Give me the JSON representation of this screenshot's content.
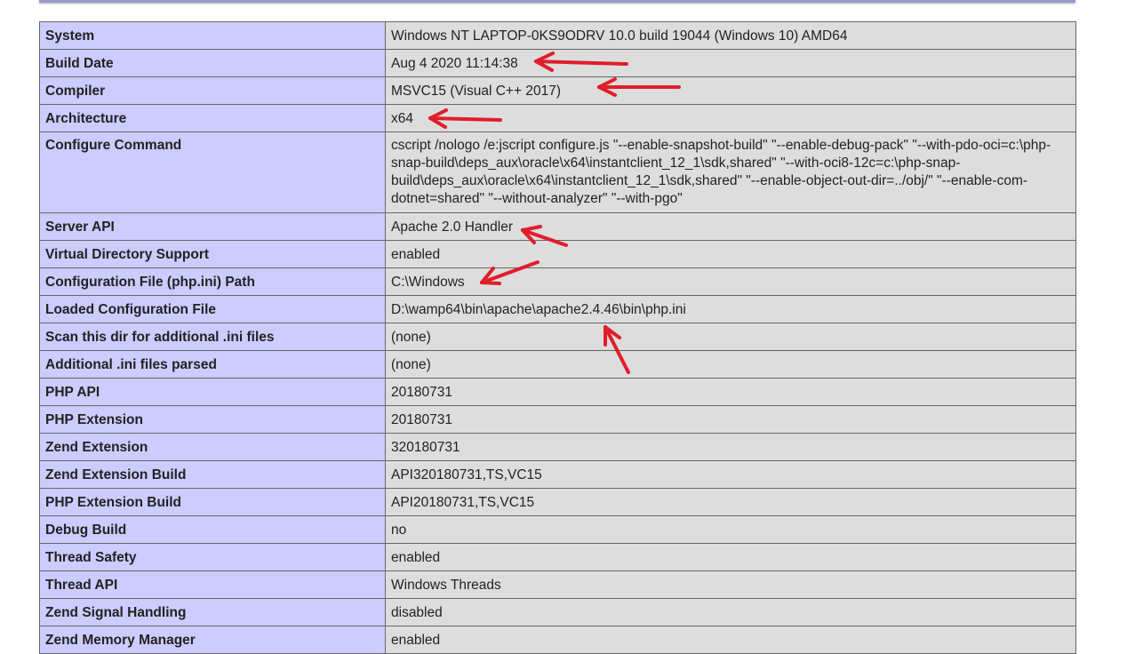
{
  "rows": [
    {
      "label": "System",
      "value": "Windows NT LAPTOP-0KS9ODRV 10.0 build 19044 (Windows 10) AMD64"
    },
    {
      "label": "Build Date",
      "value": "Aug 4 2020 11:14:38"
    },
    {
      "label": "Compiler",
      "value": "MSVC15 (Visual C++ 2017)"
    },
    {
      "label": "Architecture",
      "value": "x64"
    },
    {
      "label": "Configure Command",
      "value": "cscript /nologo /e:jscript configure.js \"--enable-snapshot-build\" \"--enable-debug-pack\" \"--with-pdo-oci=c:\\php-snap-build\\deps_aux\\oracle\\x64\\instantclient_12_1\\sdk,shared\" \"--with-oci8-12c=c:\\php-snap-build\\deps_aux\\oracle\\x64\\instantclient_12_1\\sdk,shared\" \"--enable-object-out-dir=../obj/\" \"--enable-com-dotnet=shared\" \"--without-analyzer\" \"--with-pgo\""
    },
    {
      "label": "Server API",
      "value": "Apache 2.0 Handler"
    },
    {
      "label": "Virtual Directory Support",
      "value": "enabled"
    },
    {
      "label": "Configuration File (php.ini) Path",
      "value": "C:\\Windows"
    },
    {
      "label": "Loaded Configuration File",
      "value": "D:\\wamp64\\bin\\apache\\apache2.4.46\\bin\\php.ini"
    },
    {
      "label": "Scan this dir for additional .ini files",
      "value": "(none)"
    },
    {
      "label": "Additional .ini files parsed",
      "value": "(none)"
    },
    {
      "label": "PHP API",
      "value": "20180731"
    },
    {
      "label": "PHP Extension",
      "value": "20180731"
    },
    {
      "label": "Zend Extension",
      "value": "320180731"
    },
    {
      "label": "Zend Extension Build",
      "value": "API320180731,TS,VC15"
    },
    {
      "label": "PHP Extension Build",
      "value": "API20180731,TS,VC15"
    },
    {
      "label": "Debug Build",
      "value": "no"
    },
    {
      "label": "Thread Safety",
      "value": "enabled"
    },
    {
      "label": "Thread API",
      "value": "Windows Threads"
    },
    {
      "label": "Zend Signal Handling",
      "value": "disabled"
    },
    {
      "label": "Zend Memory Manager",
      "value": "enabled"
    }
  ],
  "colors": {
    "label_cell": "#ccccff",
    "value_cell": "#dddddd",
    "border": "#666666",
    "annotation_arrow": "#e01e2a"
  }
}
